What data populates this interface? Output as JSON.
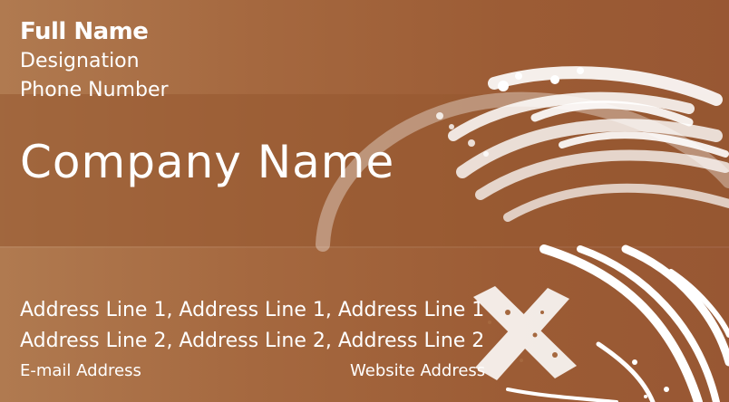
{
  "card": {
    "full_name": "Full Name",
    "designation": "Designation",
    "phone": "Phone Number",
    "company": "Company Name",
    "address_line_1": "Address Line 1,  Address Line 1,  Address Line 1",
    "address_line_2": "Address Line 2,  Address Line 2,  Address Line 2",
    "email": "E-mail Address",
    "website": "Website Address"
  },
  "colors": {
    "background": "#a5683f",
    "band": "#965830",
    "text": "#ffffff"
  },
  "graphics": {
    "swirl": "brush-stroke-swirl",
    "cross": "grunge-x-mark"
  }
}
